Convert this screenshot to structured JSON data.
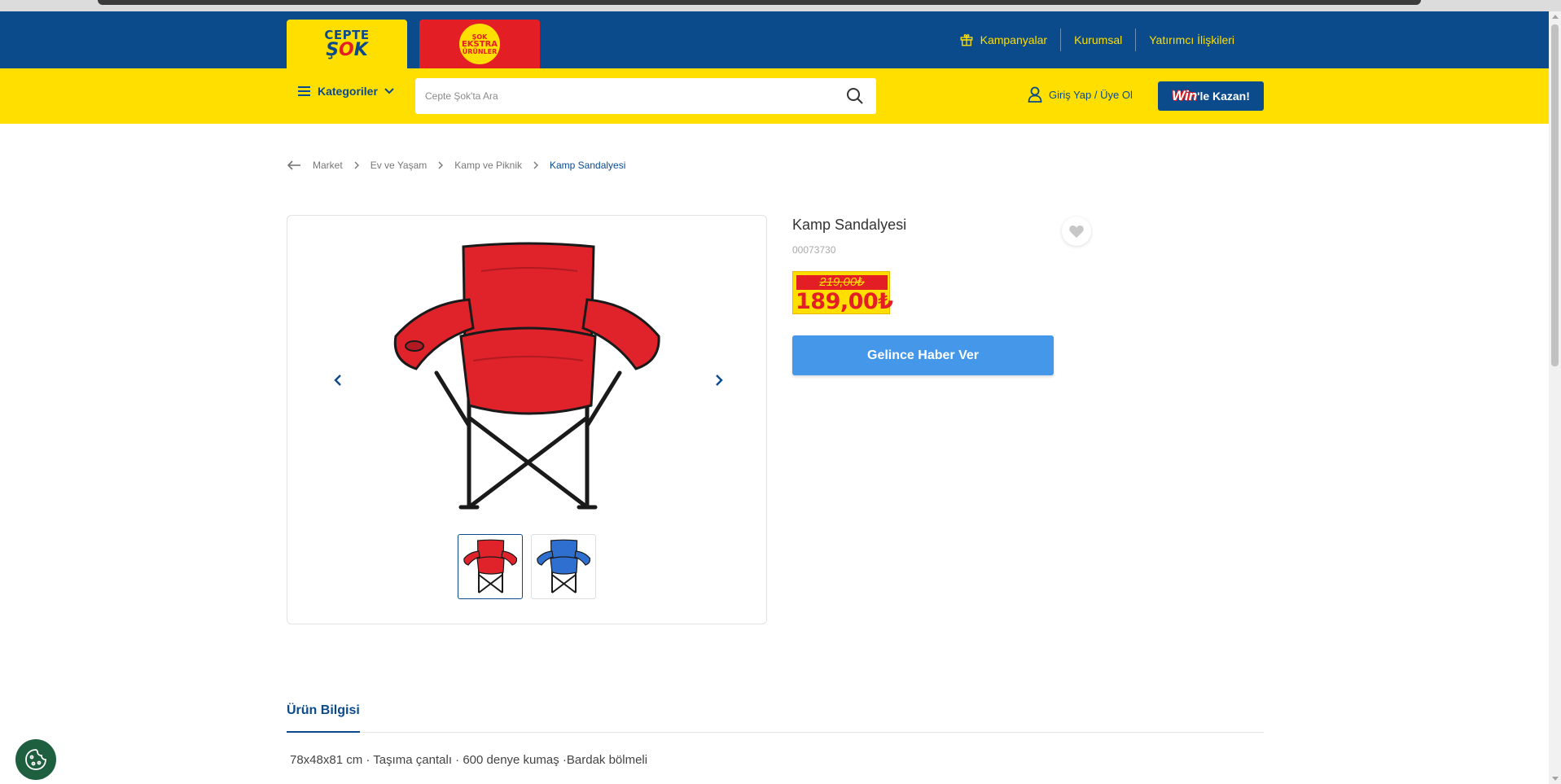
{
  "brand": {
    "cepte_line1": "CEPTE",
    "cepte_line2_a": "Ş",
    "cepte_line2_b": "O",
    "cepte_line2_c": "K",
    "ekstra_line1": "ŞOK",
    "ekstra_line2": "EKSTRA",
    "ekstra_line3": "ÜRÜNLER"
  },
  "top_nav": {
    "kampanyalar": "Kampanyalar",
    "kurumsal": "Kurumsal",
    "yatirimci": "Yatırımcı İlişkileri"
  },
  "header": {
    "categories_label": "Kategoriler",
    "search_placeholder": "Cepte Şok'ta Ara",
    "login_label": "Giriş Yap / Üye Ol",
    "win_prefix": "Win",
    "win_suffix": "'le Kazan!"
  },
  "breadcrumb": {
    "items": [
      "Market",
      "Ev ve Yaşam",
      "Kamp ve Piknik",
      "Kamp Sandalyesi"
    ]
  },
  "product": {
    "title": "Kamp Sandalyesi",
    "code": "00073730",
    "old_price": "219,00₺",
    "new_price": "189,00₺",
    "notify_label": "Gelince Haber Ver",
    "main_color": "#e0232b",
    "alt_color": "#2f6fd0"
  },
  "tabs": {
    "info_label": "Ürün Bilgisi"
  },
  "description": "78x48x81 cm · Taşıma çantalı · 600 denye kumaş ·Bardak bölmeli",
  "colors": {
    "header_blue": "#0b4a8b",
    "brand_yellow": "#ffdf00",
    "brand_red": "#e31e24",
    "button_blue": "#4497e9"
  }
}
